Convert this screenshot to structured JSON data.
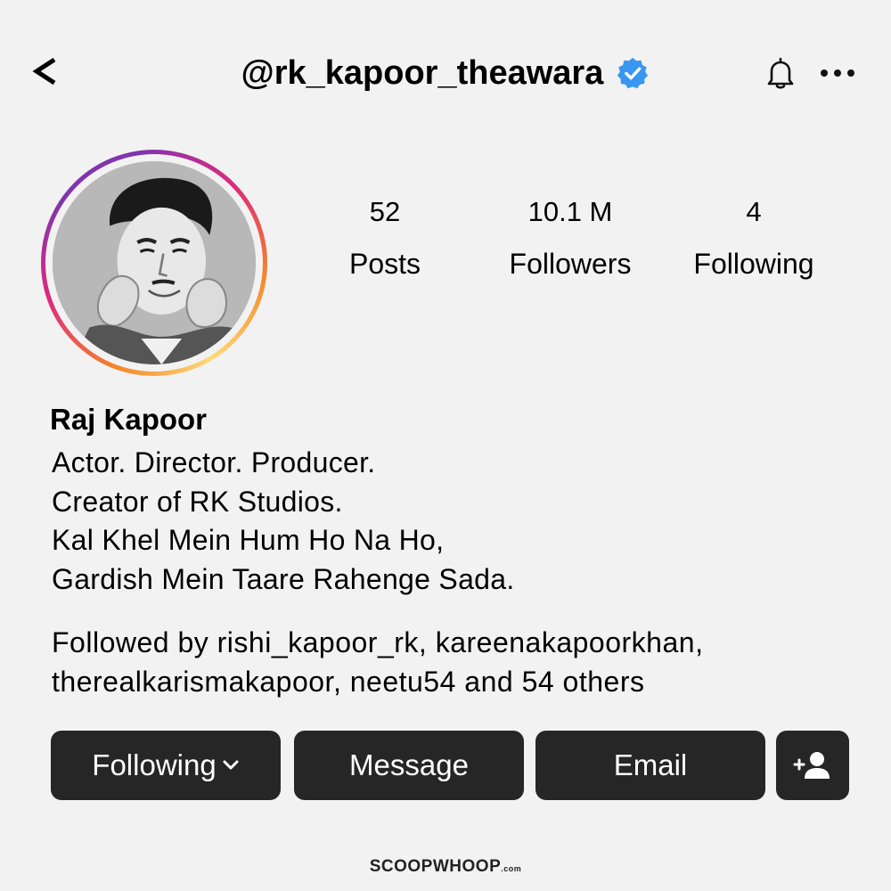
{
  "header": {
    "handle": "@rk_kapoor_theawara",
    "back_icon": "back-chevron-icon",
    "verified_icon": "verified-badge-icon",
    "bell_icon": "bell-icon",
    "more_icon": "more-horizontal-icon",
    "verified_color": "#3897f0"
  },
  "stats": {
    "posts": {
      "value": "52",
      "label": "Posts"
    },
    "followers": {
      "value": "10.1 M",
      "label": "Followers"
    },
    "following": {
      "value": "4",
      "label": "Following"
    }
  },
  "profile": {
    "name": "Raj Kapoor",
    "bio": [
      "Actor. Director. Producer.",
      "Creator of RK Studios.",
      "Kal Khel Mein Hum Ho Na Ho,",
      "Gardish Mein Taare Rahenge Sada."
    ],
    "followed_by": [
      "Followed by rishi_kapoor_rk, kareenakapoorkhan,",
      "therealkarismakapoor, neetu54 and 54 others"
    ]
  },
  "actions": {
    "following_label": "Following",
    "message_label": "Message",
    "email_label": "Email",
    "add_user_icon": "add-user-icon",
    "button_color": "#262626"
  },
  "footer": {
    "brand": "SCOOPWHOOP",
    "suffix": ".com"
  }
}
